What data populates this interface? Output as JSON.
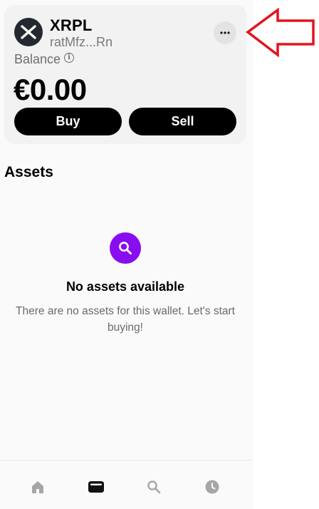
{
  "wallet": {
    "name": "XRPL",
    "address": "ratMfz...Rn",
    "balance_label": "Balance",
    "info_glyph": "i",
    "balance": "€0.00",
    "buy_label": "Buy",
    "sell_label": "Sell",
    "logo_icon": "xrp-logo-icon",
    "more_icon": "more-horizontal-icon"
  },
  "assets": {
    "title": "Assets",
    "empty_title": "No assets available",
    "empty_text": "There are no assets for this wallet. Let's start buying!",
    "empty_icon": "search-icon"
  },
  "nav": {
    "items": [
      {
        "icon": "home-icon",
        "active": false
      },
      {
        "icon": "wallet-icon",
        "active": true
      },
      {
        "icon": "search-icon",
        "active": false
      },
      {
        "icon": "clock-icon",
        "active": false
      }
    ]
  },
  "colors": {
    "accent": "#8a0cf0",
    "button_bg": "#000000",
    "annotation": "#e3141e",
    "nav_inactive": "#a6a6a6",
    "nav_active": "#111111"
  }
}
